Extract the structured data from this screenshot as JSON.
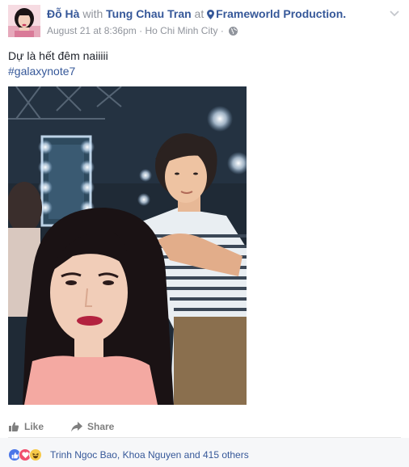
{
  "post": {
    "author": "Đỗ Hà",
    "connector_with": "with",
    "tagged_friend": "Tung Chau Tran",
    "connector_at": "at",
    "place": "Frameworld Production.",
    "timestamp": "August 21 at 8:36pm",
    "separator": "·",
    "location": "Ho Chi Minh City",
    "separator2": "·",
    "privacy_icon": "globe-icon",
    "menu_icon": "chevron-down-icon",
    "status_text": "Dự là hết đêm naiiiii",
    "hashtag": "#galaxynote7"
  },
  "actions": {
    "like_label": "Like",
    "like_icon": "thumbs-up-icon",
    "share_label": "Share",
    "share_icon": "share-arrow-icon"
  },
  "reactions": {
    "icons": [
      "like-reaction-icon",
      "love-reaction-icon",
      "haha-reaction-icon"
    ],
    "summary": "Trinh Ngoc Bao, Khoa Nguyen and 415 others"
  },
  "colors": {
    "link": "#365899",
    "meta": "#90949c",
    "action": "#7f7f7f",
    "bar_bg": "#f6f7f9"
  }
}
